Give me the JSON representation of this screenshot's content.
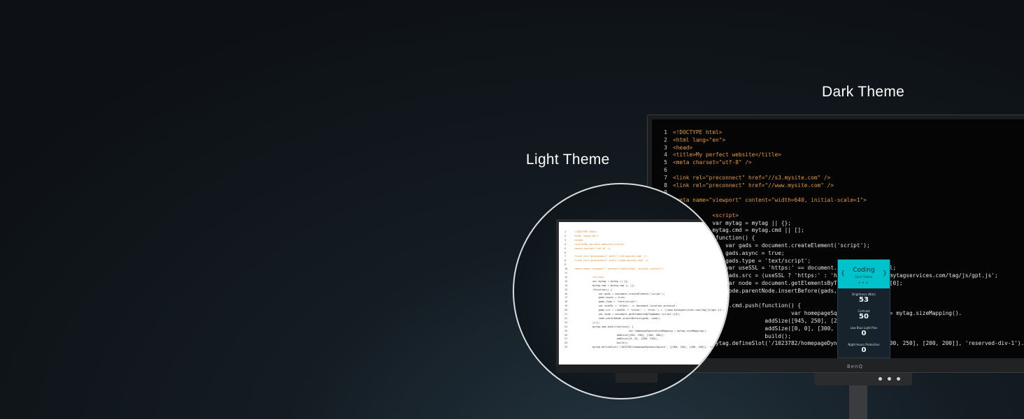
{
  "labels": {
    "dark_theme": "Dark Theme",
    "light_theme": "Light Theme"
  },
  "brand": "BenQ",
  "dark_code": [
    "<!DOCTYPE html>",
    "<html lang=\"en\">",
    "<head>",
    "<title>My perfect website</title>",
    "<meta charset=\"utf-8\" />",
    "",
    "<link rel=\"preconnect\" href=\"//s3.mysite.com\" />",
    "<link rel=\"preconnect\" href=\"//www.mysite.com\" />",
    "",
    "<meta name=\"viewport\" content=\"width=640, initial-scale=1\">",
    "",
    "            <script>",
    "            var mytag = mytag || {};",
    "            mytag.cmd = mytag.cmd || [];",
    "            (function() {",
    "                var gads = document.createElement('script');",
    "                gads.async = true;",
    "                gads.type = 'text/script';",
    "                var useSSL = 'https:' == document.location.protocol;",
    "                gads.src = (useSSL ? 'https:' : 'http:') + '//www.mytagservices.com/tag/js/gpt.js';",
    "                var node = document.getElementsByTagName('script')[0];",
    "                node.parentNode.insertBefore(gads, node);",
    "            })();",
    "            mytag.cmd.push(function() {",
    "                                    var homepageSquareSizeMapping = mytag.sizeMapping().",
    "                            addSize([945, 250], [200, 200]).",
    "                            addSize([0, 0], [300, 250]).",
    "                            build();",
    "            mytag.defineSlot('/1023782/homepageDynamicSquare', [[300, 250], [200, 200]], 'reserved-div-1')."
  ],
  "osd": {
    "title": "Coding",
    "subtitle": "Dark Theme",
    "items": [
      {
        "label": "Brightness (Nits)",
        "value": "53"
      },
      {
        "label": "Contrast",
        "value": "50"
      },
      {
        "label": "Low Blue Light Plus",
        "value": "0"
      },
      {
        "label": "Night Hours Protection",
        "value": "0"
      }
    ]
  },
  "light_code": [
    "<!DOCTYPE html>",
    "<html lang=\"en\">",
    "<head>",
    "<title>My perfect website</title>",
    "<meta charset=\"utf-8\" />",
    "",
    "<link rel=\"preconnect\" href=\"//s3.mysite.com\" />",
    "<link rel=\"preconnect\" href=\"//www.mysite.com\" />",
    "",
    "<meta name=\"viewport\" content=\"width=640, initial-scale=1\">",
    "",
    "            <script>",
    "            var mytag = mytag || {};",
    "            mytag.cmd = mytag.cmd || [];",
    "            (function() {",
    "                var gads = document.createElement('script');",
    "                gads.async = true;",
    "                gads.type = 'text/script';",
    "                var useSSL = 'https:' == document.location.protocol;",
    "                gads.src = (useSSL ? 'https:' : 'http:') + '//www.mytagservices.com/tag/js/gpt.js';",
    "                var node = document.getElementsByTagName('script')[0];",
    "                node.parentNode.insertBefore(gads, node);",
    "            })();",
    "            mytag.cmd.push(function() {",
    "                                    var homepageSquareSizeMapping = mytag.sizeMapping().",
    "                            addSize([945, 250], [200, 200]).",
    "                            addSize([0, 0], [300, 250]).",
    "                            build();",
    "            mytag.defineSlot('/1023782/homepageDynamicSquare', [[300, 250], [200, 200]], 'reserved-div-1')."
  ],
  "colors": {
    "tag": "#e59a3b",
    "string": "#f0c24a",
    "url": "#5fb8e6",
    "osd_accent": "#00c2cc"
  }
}
